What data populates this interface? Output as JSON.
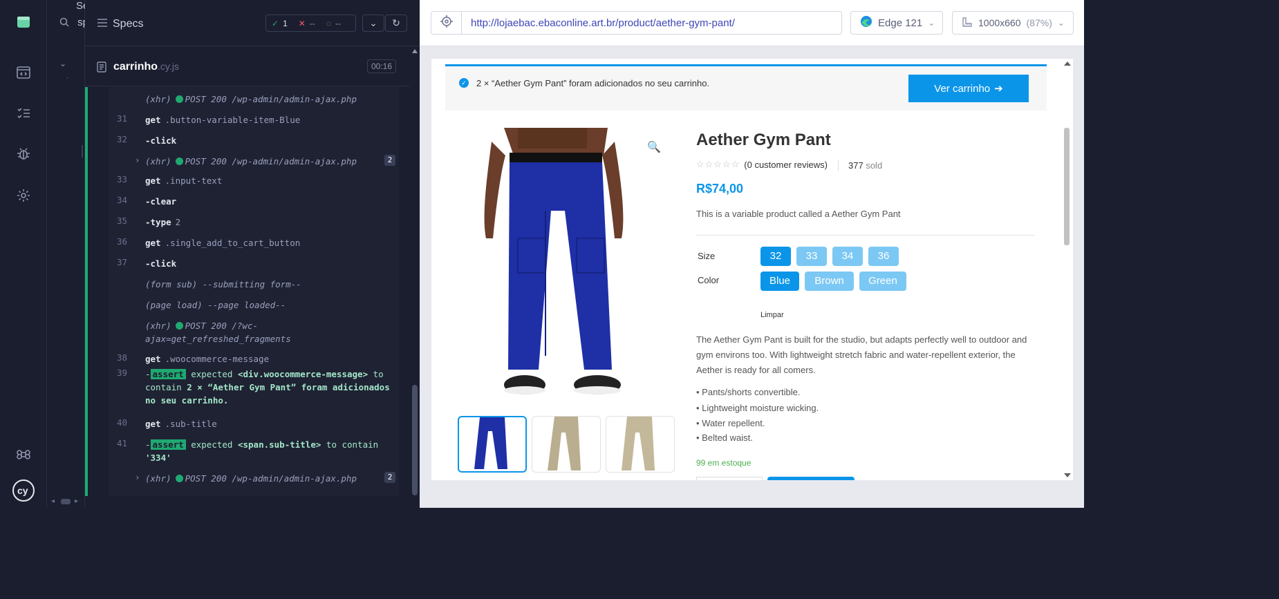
{
  "specs_sidebar": {
    "search_label": "Search",
    "search_placeholder": "specs",
    "specs_label": "Specs"
  },
  "reporter": {
    "stats": {
      "passed": "1",
      "failed": "--",
      "pending": "--"
    },
    "file": {
      "name": "carrinho",
      "ext": ".cy.js",
      "duration": "00:16"
    },
    "commands": [
      {
        "num": "",
        "kind": "xhr",
        "text": "(xhr)",
        "method": "POST 200 /wp-admin/admin-ajax.php"
      },
      {
        "num": "31",
        "kind": "get",
        "cmd": "get",
        "arg": ".button-variable-item-Blue"
      },
      {
        "num": "32",
        "kind": "action",
        "cmd": "-click",
        "arg": ""
      },
      {
        "num": "",
        "kind": "xhr",
        "text": "(xhr)",
        "method": "POST 200 /wp-admin/admin-ajax.php",
        "count": "2"
      },
      {
        "num": "33",
        "kind": "get",
        "cmd": "get",
        "arg": ".input-text"
      },
      {
        "num": "34",
        "kind": "action",
        "cmd": "-clear",
        "arg": ""
      },
      {
        "num": "35",
        "kind": "action",
        "cmd": "-type",
        "arg": "2"
      },
      {
        "num": "36",
        "kind": "get",
        "cmd": "get",
        "arg": ".single_add_to_cart_button"
      },
      {
        "num": "37",
        "kind": "action",
        "cmd": "-click",
        "arg": ""
      },
      {
        "num": "",
        "kind": "event",
        "text": "(form sub)  --submitting form--"
      },
      {
        "num": "",
        "kind": "event",
        "text": "(page load)  --page loaded--"
      },
      {
        "num": "",
        "kind": "xhr2",
        "text": "(xhr)",
        "method": "POST 200 /?wc-",
        "method2": "ajax=get_refreshed_fragments"
      },
      {
        "num": "38",
        "kind": "get",
        "cmd": "get",
        "arg": ".woocommerce-message"
      },
      {
        "num": "39",
        "kind": "assert",
        "tag": "assert",
        "line1": "expected",
        "el": "<div.woocommerce-message>",
        "to": "to",
        "line2": "contain",
        "val": "2 × “Aether Gym Pant” foram adicionados",
        "val2": "no seu carrinho."
      },
      {
        "num": "40",
        "kind": "get",
        "cmd": "get",
        "arg": ".sub-title"
      },
      {
        "num": "41",
        "kind": "assert2",
        "tag": "assert",
        "line1": "expected",
        "el": "<span.sub-title>",
        "to": "to contain",
        "val": "'334'"
      },
      {
        "num": "",
        "kind": "xhr",
        "text": "(xhr)",
        "method": "POST 200 /wp-admin/admin-ajax.php",
        "count": "2"
      }
    ]
  },
  "browser": {
    "url": "http://lojaebac.ebaconline.art.br/product/aether-gym-pant/",
    "browser_name": "Edge 121",
    "viewport": "1000x660",
    "zoom": "(87%)"
  },
  "page": {
    "notice_text": "2 × “Aether Gym Pant” foram adicionados no seu carrinho.",
    "view_cart_label": "Ver carrinho",
    "product_title": "Aether Gym Pant",
    "reviews": "(0 customer reviews)",
    "sold_count": "377",
    "sold_label": "sold",
    "price": "R$74,00",
    "short_description": "This is a variable product called a Aether Gym Pant",
    "size_label": "Size",
    "sizes": [
      "32",
      "33",
      "34",
      "36"
    ],
    "selected_size": "32",
    "color_label": "Color",
    "colors": [
      "Blue",
      "Brown",
      "Green"
    ],
    "selected_color": "Blue",
    "clear_label": "Limpar",
    "description": "The Aether Gym Pant is built for the studio, but adapts perfectly well to outdoor and gym environs too. With lightweight stretch fabric and water-repellent exterior, the Aether is ready for all comers.",
    "bullets": [
      "• Pants/shorts convertible.",
      "• Lightweight moisture wicking.",
      "• Water repellent.",
      "• Belted waist."
    ],
    "stock": "99 em estoque",
    "colors_hex": {
      "accent": "#0b95e9",
      "pant_blue": "#1f2fa6",
      "pant_khaki": "#b9ae8f"
    }
  }
}
